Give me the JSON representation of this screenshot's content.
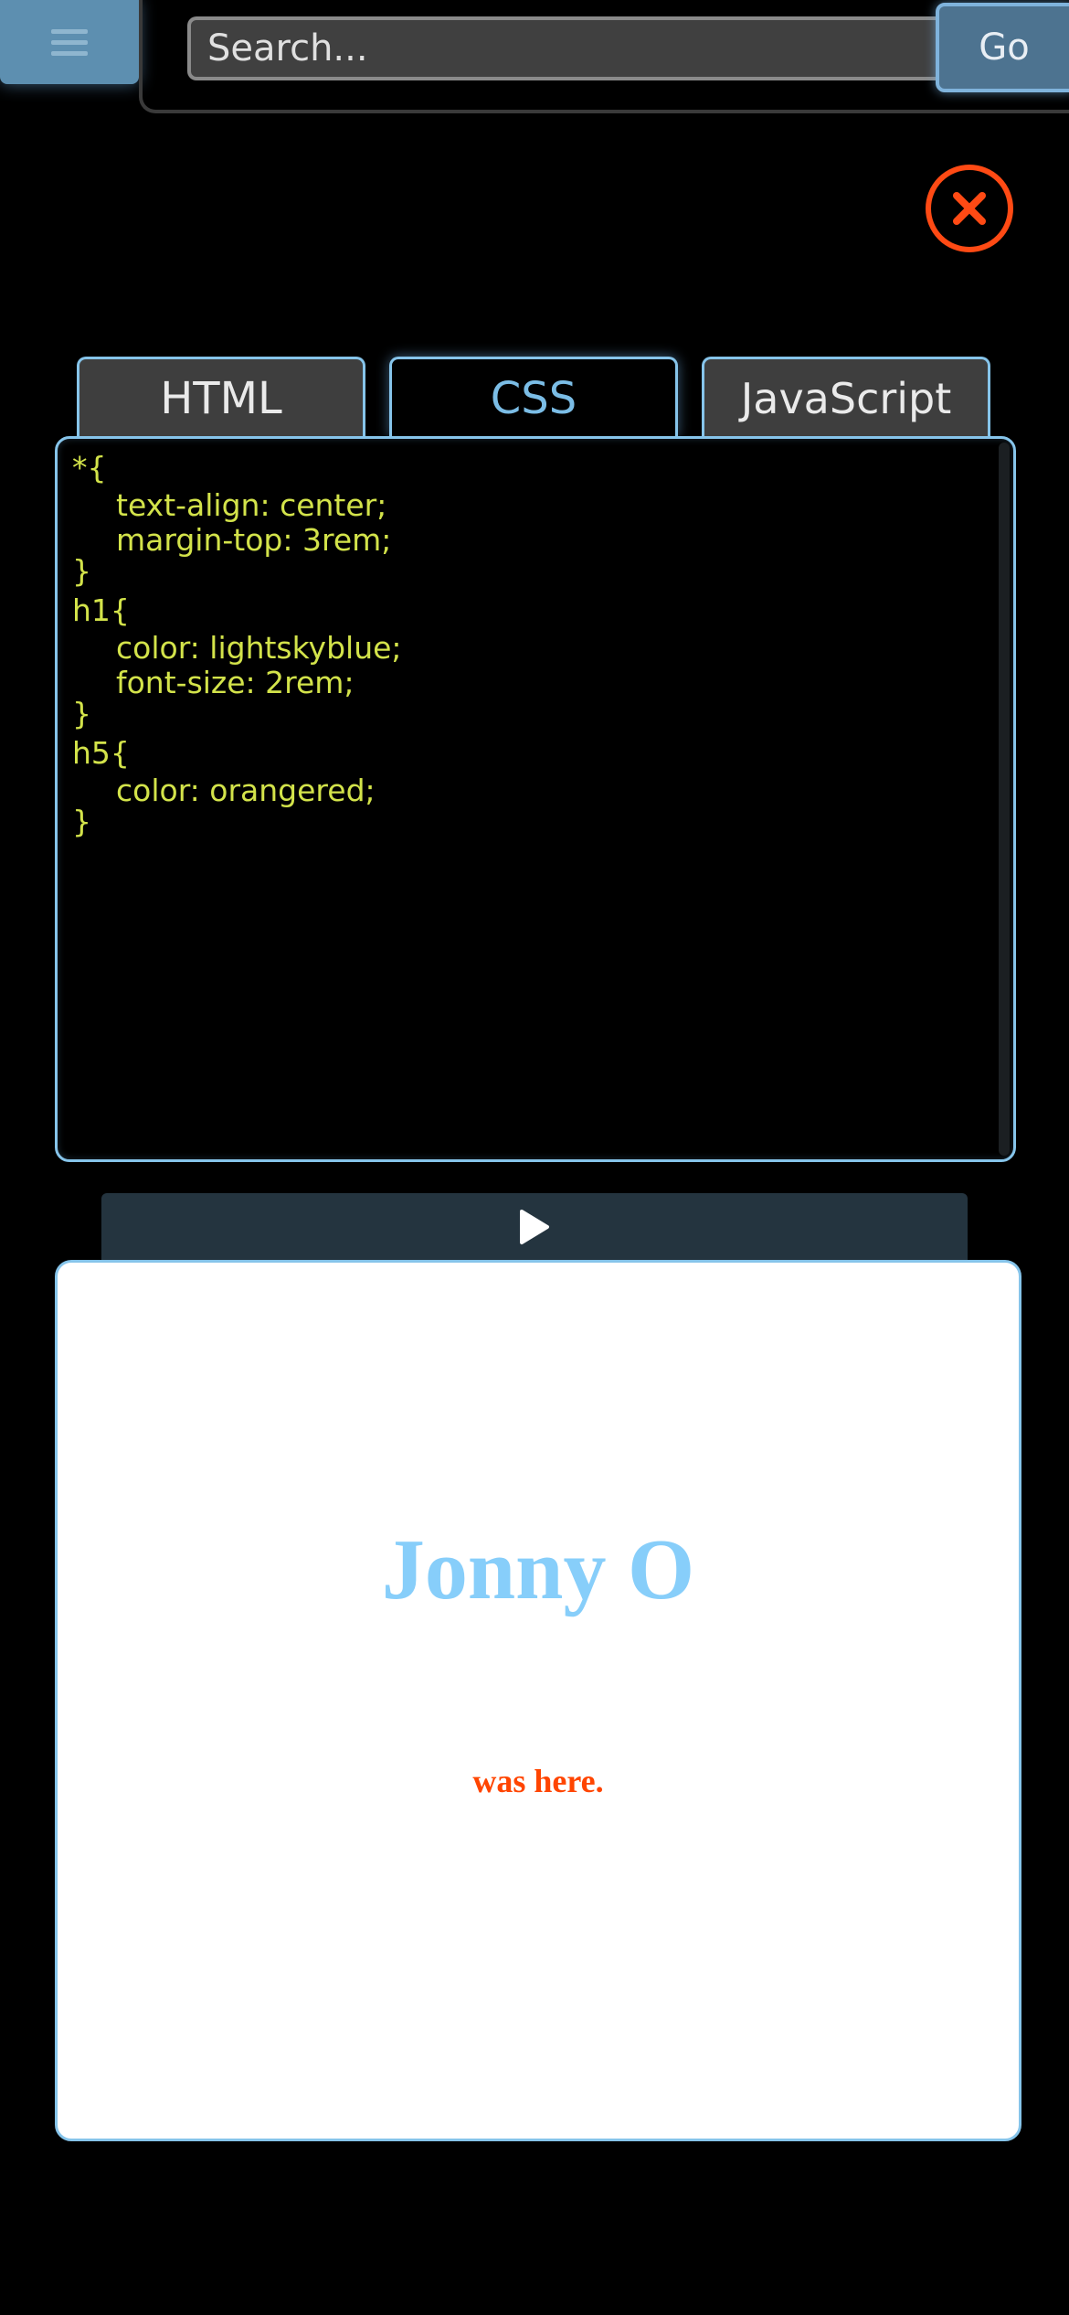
{
  "header": {
    "search_placeholder": "Search...",
    "go_label": "Go"
  },
  "tabs": [
    {
      "label": "HTML",
      "active": false
    },
    {
      "label": "CSS",
      "active": true
    },
    {
      "label": "JavaScript",
      "active": false
    }
  ],
  "editor": {
    "language": "CSS",
    "lines": [
      {
        "text": "*{",
        "indent": 0
      },
      {
        "text": "text-align: center;",
        "indent": 1
      },
      {
        "text": "margin-top: 3rem;",
        "indent": 1
      },
      {
        "text": "}",
        "indent": 0
      },
      {
        "text": "h1{",
        "indent": 0
      },
      {
        "text": "color: lightskyblue;",
        "indent": 1
      },
      {
        "text": "font-size: 2rem;",
        "indent": 1
      },
      {
        "text": "}",
        "indent": 0
      },
      {
        "text": "h5{",
        "indent": 0
      },
      {
        "text": "color: orangered;",
        "indent": 1
      },
      {
        "text": "}",
        "indent": 0
      }
    ]
  },
  "preview": {
    "heading": "Jonny O",
    "subheading": "was here."
  },
  "colors": {
    "accent_blue": "#86c4ea",
    "close_orange": "#ff4a14",
    "code_text": "#d3e34a",
    "preview_heading": "#87cefa",
    "preview_subheading": "#ff4500"
  },
  "icons": {
    "menu": "hamburger-menu-icon",
    "close": "close-icon",
    "run": "play-icon"
  }
}
